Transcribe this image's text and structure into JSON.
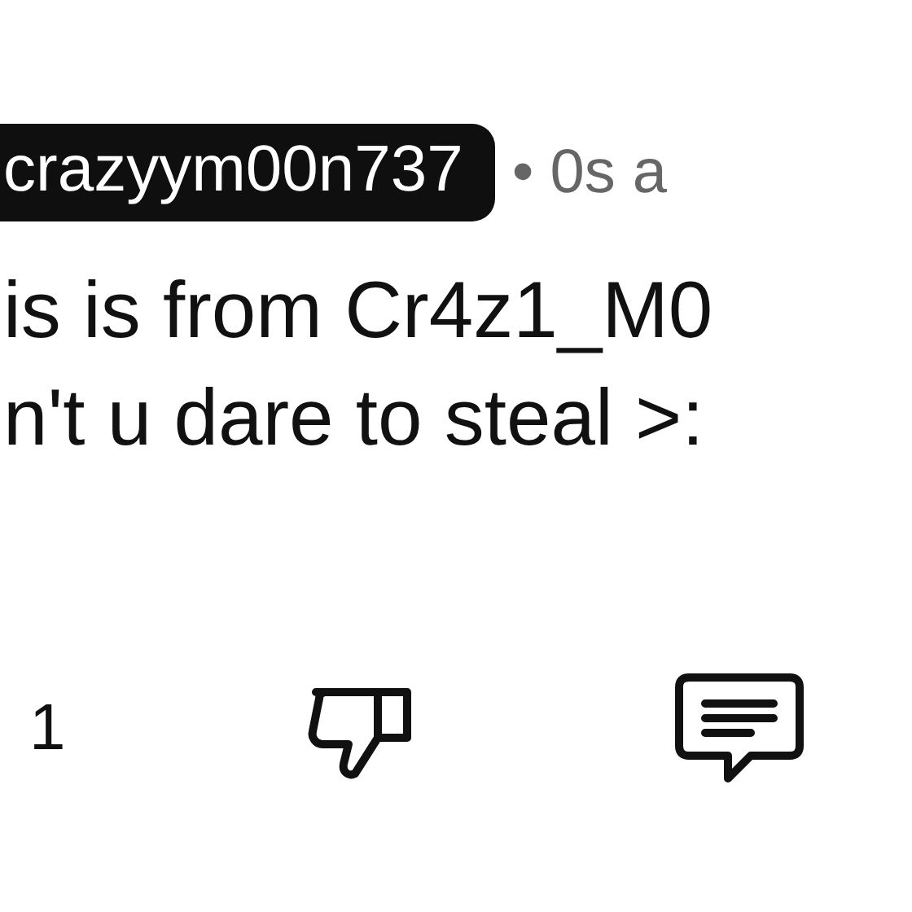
{
  "comment": {
    "author": "crazyym00n737",
    "separator": "•",
    "time": "0s a",
    "lines": [
      "is is from Cr4z1_M0",
      "n't u dare to steal >:"
    ]
  },
  "actions": {
    "like_count": "1"
  }
}
